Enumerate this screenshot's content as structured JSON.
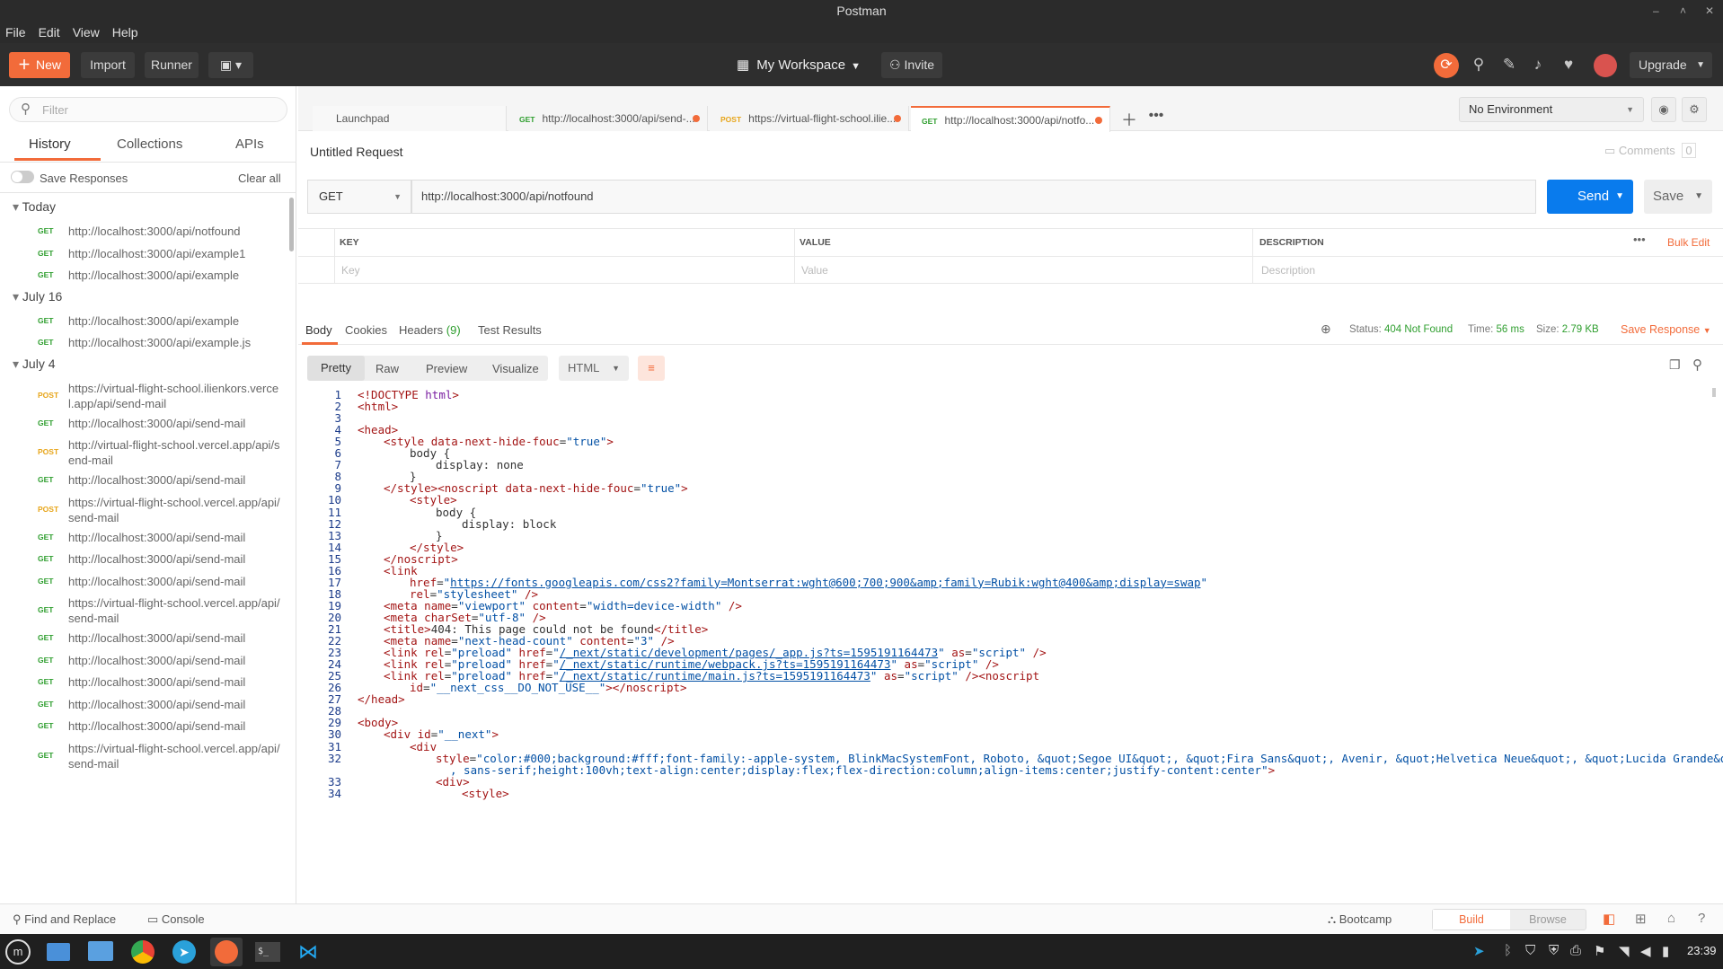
{
  "window": {
    "title": "Postman"
  },
  "menu": [
    "File",
    "Edit",
    "View",
    "Help"
  ],
  "header": {
    "new_label": "New",
    "import_label": "Import",
    "runner_label": "Runner",
    "workspace": "My Workspace",
    "invite_label": "Invite",
    "upgrade_label": "Upgrade"
  },
  "sidebar": {
    "search_placeholder": "Filter",
    "tabs": [
      "History",
      "Collections",
      "APIs"
    ],
    "save_responses": "Save Responses",
    "clear_all": "Clear all",
    "groups": [
      {
        "label": "Today",
        "items": [
          {
            "method": "GET",
            "url": "http://localhost:3000/api/notfound"
          },
          {
            "method": "GET",
            "url": "http://localhost:3000/api/example1"
          },
          {
            "method": "GET",
            "url": "http://localhost:3000/api/example"
          }
        ]
      },
      {
        "label": "July 16",
        "items": [
          {
            "method": "GET",
            "url": "http://localhost:3000/api/example"
          },
          {
            "method": "GET",
            "url": "http://localhost:3000/api/example.js"
          }
        ]
      },
      {
        "label": "July 4",
        "items": [
          {
            "method": "POST",
            "url": "https://virtual-flight-school.ilienkors.vercel.app/api/send-mail"
          },
          {
            "method": "GET",
            "url": "http://localhost:3000/api/send-mail"
          },
          {
            "method": "POST",
            "url": "http://virtual-flight-school.vercel.app/api/send-mail"
          },
          {
            "method": "GET",
            "url": "http://localhost:3000/api/send-mail"
          },
          {
            "method": "POST",
            "url": "https://virtual-flight-school.vercel.app/api/send-mail"
          },
          {
            "method": "GET",
            "url": "http://localhost:3000/api/send-mail"
          },
          {
            "method": "GET",
            "url": "http://localhost:3000/api/send-mail"
          },
          {
            "method": "GET",
            "url": "http://localhost:3000/api/send-mail"
          },
          {
            "method": "GET",
            "url": "https://virtual-flight-school.vercel.app/api/send-mail"
          },
          {
            "method": "GET",
            "url": "http://localhost:3000/api/send-mail"
          },
          {
            "method": "GET",
            "url": "http://localhost:3000/api/send-mail"
          },
          {
            "method": "GET",
            "url": "http://localhost:3000/api/send-mail"
          },
          {
            "method": "GET",
            "url": "http://localhost:3000/api/send-mail"
          },
          {
            "method": "GET",
            "url": "http://localhost:3000/api/send-mail"
          },
          {
            "method": "GET",
            "url": "https://virtual-flight-school.vercel.app/api/send-mail"
          }
        ]
      }
    ]
  },
  "tabs": [
    {
      "method": "",
      "label": "Launchpad"
    },
    {
      "method": "GET",
      "label": "http://localhost:3000/api/send-..."
    },
    {
      "method": "POST",
      "label": "https://virtual-flight-school.ilie..."
    },
    {
      "method": "GET",
      "label": "http://localhost:3000/api/notfo..."
    }
  ],
  "environment": "No Environment",
  "request": {
    "name": "Untitled Request",
    "comments_label": "Comments",
    "comments_count": "0",
    "method": "GET",
    "url": "http://localhost:3000/api/notfound",
    "send_label": "Send",
    "save_label": "Save",
    "params": {
      "key_header": "KEY",
      "value_header": "VALUE",
      "desc_header": "DESCRIPTION",
      "bulk_edit": "Bulk Edit",
      "key_ph": "Key",
      "value_ph": "Value",
      "desc_ph": "Description"
    }
  },
  "response": {
    "tabs": [
      "Body",
      "Cookies",
      "Headers",
      "Test Results"
    ],
    "headers_count": "(9)",
    "status_label": "Status:",
    "status": "404 Not Found",
    "time_label": "Time:",
    "time": "56 ms",
    "size_label": "Size:",
    "size": "2.79 KB",
    "save_response": "Save Response",
    "view_tabs": [
      "Pretty",
      "Raw",
      "Preview",
      "Visualize"
    ],
    "format": "HTML"
  },
  "statusbar": {
    "find_replace": "Find and Replace",
    "console": "Console",
    "bootcamp": "Bootcamp",
    "build": "Build",
    "browse": "Browse"
  },
  "clock": "23:39",
  "colors": {
    "accent": "#f26b3a",
    "send": "#097bed",
    "status_ok": "#2e9e2e"
  }
}
